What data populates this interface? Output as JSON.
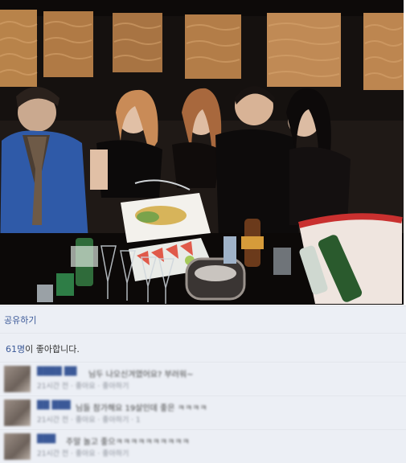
{
  "post": {
    "share_label": "공유하기",
    "likes_count": "61명",
    "likes_suffix": "이 좋아합니다."
  },
  "comments": [
    {
      "author": "████ ██",
      "text": "님두 나오신겨였어요? 부러워~",
      "meta": "21시간 전 · 좋아요 · 좋아하기"
    },
    {
      "author": "██ ███",
      "text": "님들 참가해요 19살인데 좋은 ㅋㅋㅋㅋ",
      "meta": "21시간 전 · 좋아요 · 좋아하기 · 1"
    },
    {
      "author": "███",
      "text": "주말 놀고 좋으ㅋㅋㅋㅋㅋㅋㅋㅋㅋㅋ",
      "meta": "21시간 전 · 좋아요 · 좋아하기"
    }
  ]
}
